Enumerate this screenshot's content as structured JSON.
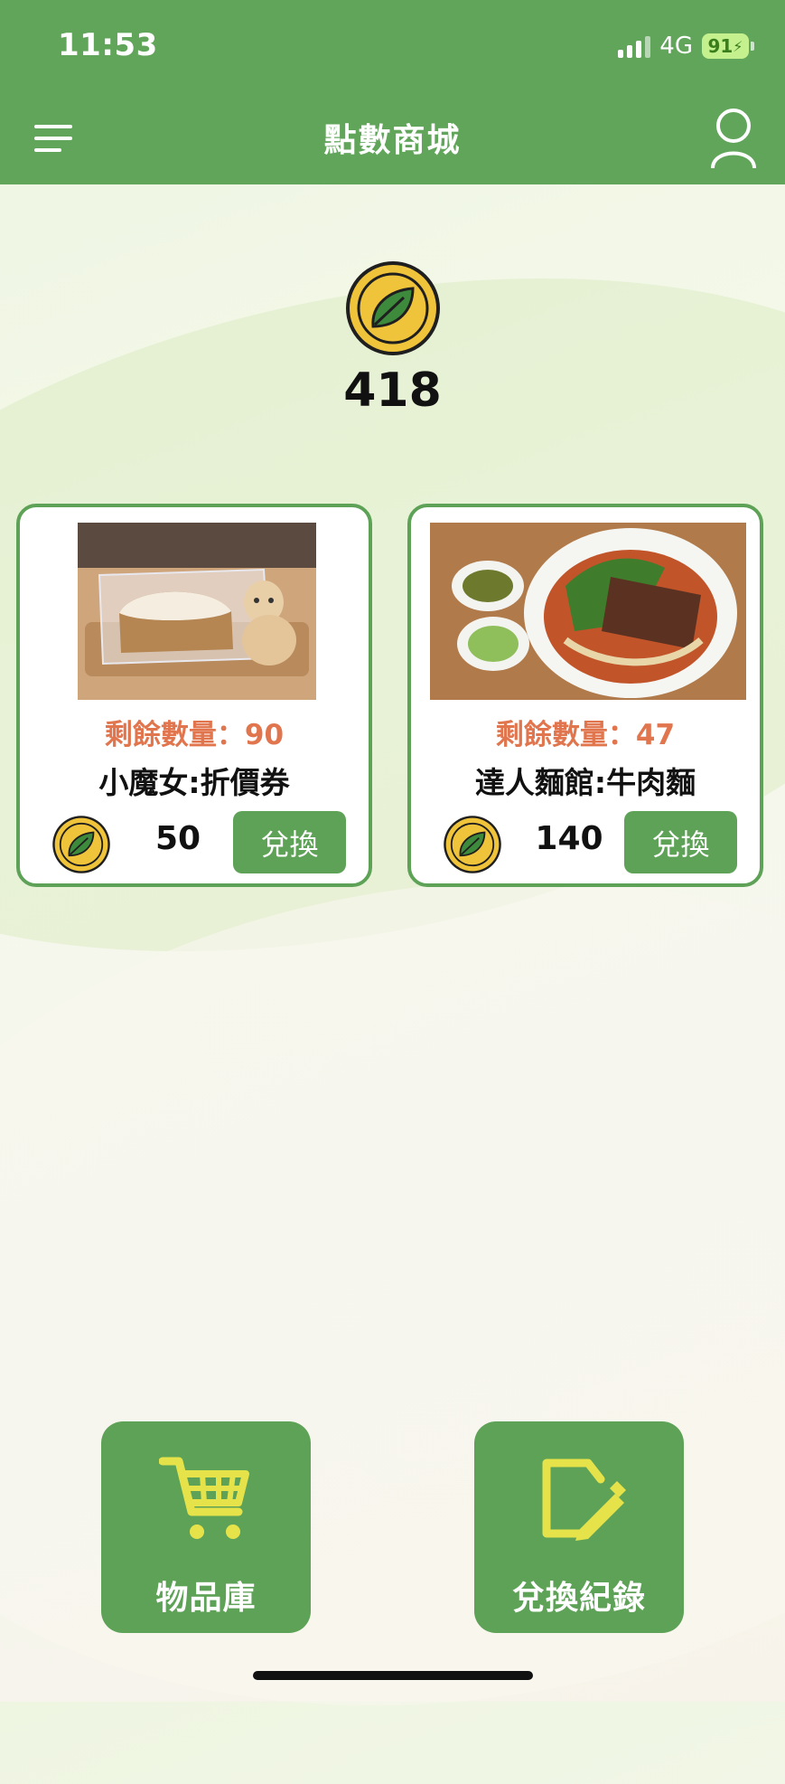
{
  "status_bar": {
    "time": "11:53",
    "network": "4G",
    "battery": "91"
  },
  "header": {
    "title": "點數商城"
  },
  "balance": {
    "points": "418"
  },
  "products": [
    {
      "remaining_label": "剩餘數量：90",
      "name": "小魔女:折價券",
      "price": "50",
      "button": "兌換"
    },
    {
      "remaining_label": "剩餘數量：47",
      "name": "達人麵館:牛肉麵",
      "price": "140",
      "button": "兌換"
    }
  ],
  "bottom_actions": {
    "inventory_label": "物品庫",
    "history_label": "兌換紀錄"
  },
  "colors": {
    "primary_green": "#60a55a",
    "accent_yellow": "#e6e34a",
    "remaining_orange": "#e0754e",
    "coin_gold": "#f0c43a"
  }
}
